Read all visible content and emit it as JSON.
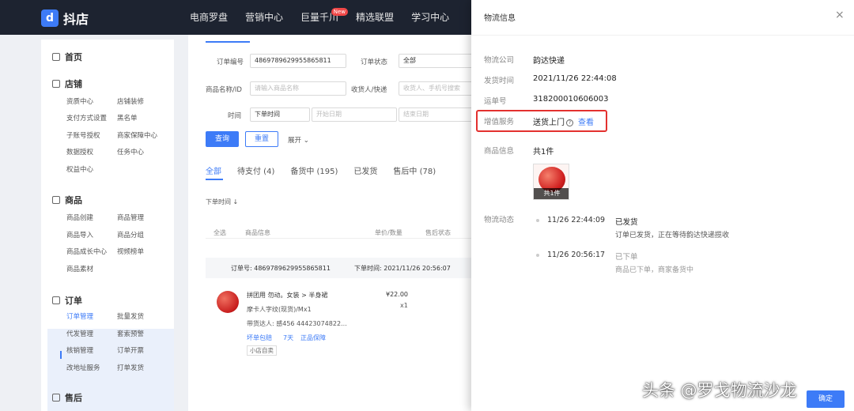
{
  "brand": {
    "name": "抖店"
  },
  "nav": [
    {
      "label": "电商罗盘"
    },
    {
      "label": "营销中心"
    },
    {
      "label": "巨量千川",
      "badge": "New"
    },
    {
      "label": "精选联盟"
    },
    {
      "label": "学习中心"
    }
  ],
  "sidebar": {
    "home": "首页",
    "shop": {
      "title": "店铺",
      "items": [
        "资质中心",
        "店铺装修",
        "支付方式设置",
        "黑名单",
        "子账号授权",
        "商家保障中心",
        "数据授权",
        "任务中心",
        "权益中心"
      ]
    },
    "goods": {
      "title": "商品",
      "items": [
        "商品创建",
        "商品管理",
        "商品导入",
        "商品分组",
        "商品成长中心",
        "视频榜单",
        "商品素材"
      ]
    },
    "orders": {
      "title": "订单",
      "items": [
        "订单管理",
        "批量发货",
        "代发管理",
        "套索预警",
        "核销管理",
        "订单开票",
        "改地址服务",
        "打单发货"
      ]
    },
    "aftersale": {
      "title": "售后"
    }
  },
  "filters": {
    "order_no_label": "订单编号",
    "order_no_value": "4869789629955865811",
    "order_status_label": "订单状态",
    "order_status_value": "全部",
    "goods_label": "商品名称/ID",
    "goods_placeholder": "请输入商品名称",
    "receiver_label": "收货人/快递",
    "receiver_placeholder": "收货人、手机号搜索",
    "time_label": "时间",
    "time_type": "下单时间",
    "time_start_placeholder": "开始日期",
    "time_end_placeholder": "结束日期",
    "query_button": "查询",
    "reset_button": "重置",
    "expand_label": "展开"
  },
  "tabs": [
    "全部",
    "待支付 (4)",
    "备货中 (195)",
    "已发货",
    "售后中 (78)"
  ],
  "list": {
    "sort_label": "下单时间",
    "select_all": "全选",
    "col_product": "商品信息",
    "col_price": "单价/数量",
    "col_after": "售后状态",
    "order_no_text": "订单号: 4869789629955865811",
    "order_time_text": "下单时间: 2021/11/26 20:56:07",
    "product_title": "拼团用 勿动。女装 > 半身裙",
    "product_spec": "摩卡人字纹(现货)/Mx1",
    "product_extra": "带货达人: 感456 44423074822...",
    "price": "¥22.00",
    "qty": "x1",
    "link_1": "坏单包赔",
    "link_2": "7天",
    "link_3": "正品保障",
    "tag": "小店自卖"
  },
  "drawer": {
    "title": "物流信息",
    "close": "×",
    "company_label": "物流公司",
    "company_value": "韵达快递",
    "ship_time_label": "发货时间",
    "ship_time_value": "2021/11/26 22:44:08",
    "waybill_label": "运单号",
    "waybill_value": "318200010606003",
    "service_label": "增值服务",
    "service_value": "送货上门",
    "service_link": "查看",
    "goods_label": "商品信息",
    "goods_value": "共1件",
    "thumb_badge": "共1件",
    "tracking_label": "物流动态",
    "tracking": [
      {
        "time": "11/26 22:44:09",
        "status": "已发货",
        "desc": "订单已发货，正在等待韵达快递揽收"
      },
      {
        "time": "11/26 20:56:17",
        "status": "已下单",
        "desc": "商品已下单，商家备货中"
      }
    ],
    "confirm_button": "确定"
  },
  "watermark": "头条 @罗戈物流沙龙"
}
